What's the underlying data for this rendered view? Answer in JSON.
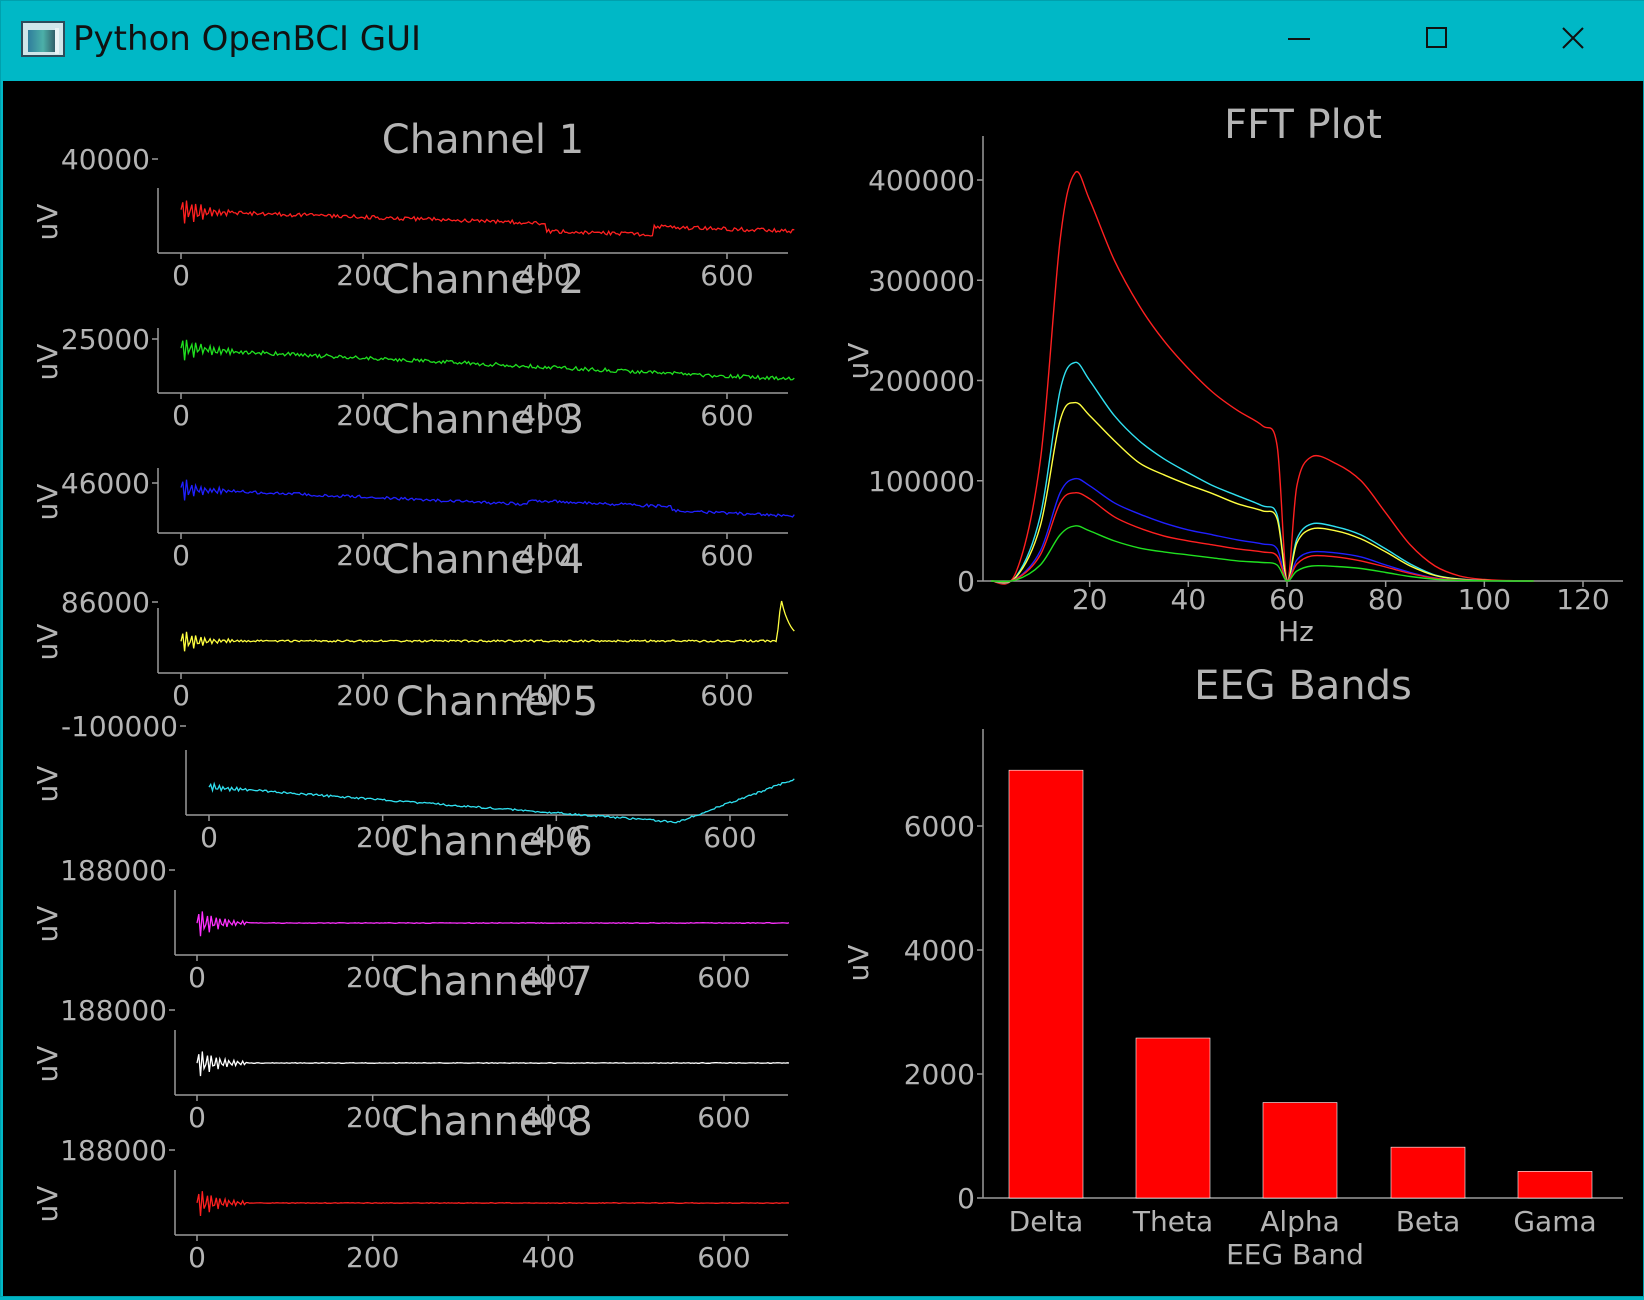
{
  "window": {
    "title": "Python OpenBCI GUI",
    "icon": "app-window-icon",
    "controls": [
      {
        "name": "minimize-button",
        "icon": "minimize-icon"
      },
      {
        "name": "maximize-button",
        "icon": "maximize-icon"
      },
      {
        "name": "close-button",
        "icon": "close-icon"
      }
    ]
  },
  "channels": [
    {
      "title": "Channel 1",
      "ylabel": "uV",
      "ytick": "40000",
      "color": "#ff2020"
    },
    {
      "title": "Channel 2",
      "ylabel": "uV",
      "ytick": "25000",
      "color": "#20e020"
    },
    {
      "title": "Channel 3",
      "ylabel": "uV",
      "ytick": "46000",
      "color": "#2020ff"
    },
    {
      "title": "Channel 4",
      "ylabel": "uV",
      "ytick": "86000",
      "color": "#ffff40"
    },
    {
      "title": "Channel 5",
      "ylabel": "uV",
      "ytick": "-100000",
      "color": "#30e0f0"
    },
    {
      "title": "Channel 6",
      "ylabel": "uV",
      "ytick": "188000",
      "color": "#ff30ff"
    },
    {
      "title": "Channel 7",
      "ylabel": "uV",
      "ytick": "188000",
      "color": "#ffffff"
    },
    {
      "title": "Channel 8",
      "ylabel": "uV",
      "ytick": "188000",
      "color": "#ff2020"
    }
  ],
  "channel_xticks": [
    "0",
    "200",
    "400",
    "600"
  ],
  "chart_data": [
    {
      "type": "line",
      "title": "FFT Plot",
      "xlabel": "Hz",
      "ylabel": "uV",
      "xlim": [
        0,
        130
      ],
      "ylim": [
        0,
        400000
      ],
      "xticks": [
        "20",
        "40",
        "60",
        "80",
        "100",
        "120"
      ],
      "yticks": [
        "0",
        "100000",
        "200000",
        "300000",
        "400000"
      ],
      "grid": false,
      "x": [
        0,
        5,
        10,
        14,
        17,
        20,
        25,
        30,
        35,
        40,
        45,
        50,
        55,
        58,
        60,
        62,
        65,
        70,
        75,
        80,
        85,
        90,
        95,
        100,
        105,
        110
      ],
      "series": [
        {
          "color": "#ff2020",
          "values": [
            0,
            8000,
            120000,
            340000,
            407000,
            380000,
            320000,
            275000,
            240000,
            212000,
            188000,
            170000,
            155000,
            135000,
            0,
            95000,
            124000,
            117000,
            100000,
            68000,
            36000,
            15000,
            5000,
            1500,
            400,
            0
          ]
        },
        {
          "color": "#30e0f0",
          "values": [
            0,
            4000,
            65000,
            190000,
            218000,
            200000,
            165000,
            140000,
            122000,
            108000,
            95000,
            85000,
            75000,
            66000,
            0,
            42000,
            57000,
            54000,
            46000,
            32000,
            17000,
            6000,
            2000,
            600,
            100,
            0
          ]
        },
        {
          "color": "#ffff40",
          "values": [
            0,
            3500,
            55000,
            160000,
            178000,
            165000,
            140000,
            118000,
            106000,
            96000,
            87000,
            77000,
            70000,
            62000,
            0,
            38000,
            52000,
            50000,
            42000,
            29000,
            15000,
            5500,
            1800,
            500,
            100,
            0
          ]
        },
        {
          "color": "#2020ff",
          "values": [
            0,
            2000,
            30000,
            88000,
            102000,
            95000,
            78000,
            67000,
            58000,
            51000,
            46000,
            41000,
            37000,
            32000,
            0,
            21000,
            29000,
            28000,
            24000,
            16000,
            8500,
            3000,
            1000,
            300,
            50,
            0
          ]
        },
        {
          "color": "#ff2020",
          "values": [
            0,
            1800,
            26000,
            78000,
            88000,
            82000,
            64000,
            53000,
            45000,
            40000,
            36000,
            32000,
            29000,
            25000,
            0,
            17000,
            25000,
            24000,
            20000,
            14000,
            7500,
            2700,
            900,
            300,
            50,
            0
          ]
        },
        {
          "color": "#20e020",
          "values": [
            0,
            1000,
            16000,
            46000,
            55000,
            50000,
            40000,
            33000,
            29000,
            26000,
            23000,
            20000,
            18500,
            16000,
            0,
            10000,
            15000,
            14500,
            12500,
            8500,
            4500,
            1700,
            600,
            200,
            30,
            0
          ]
        }
      ]
    },
    {
      "type": "bar",
      "title": "EEG Bands",
      "xlabel": "EEG Band",
      "ylabel": "uV",
      "ylim": [
        0,
        7600
      ],
      "yticks": [
        "0",
        "2000",
        "4000",
        "6000"
      ],
      "categories": [
        "Delta",
        "Theta",
        "Alpha",
        "Beta",
        "Gama"
      ],
      "values": [
        6900,
        2580,
        1540,
        820,
        430
      ],
      "bar_color": "#ff0000"
    }
  ]
}
